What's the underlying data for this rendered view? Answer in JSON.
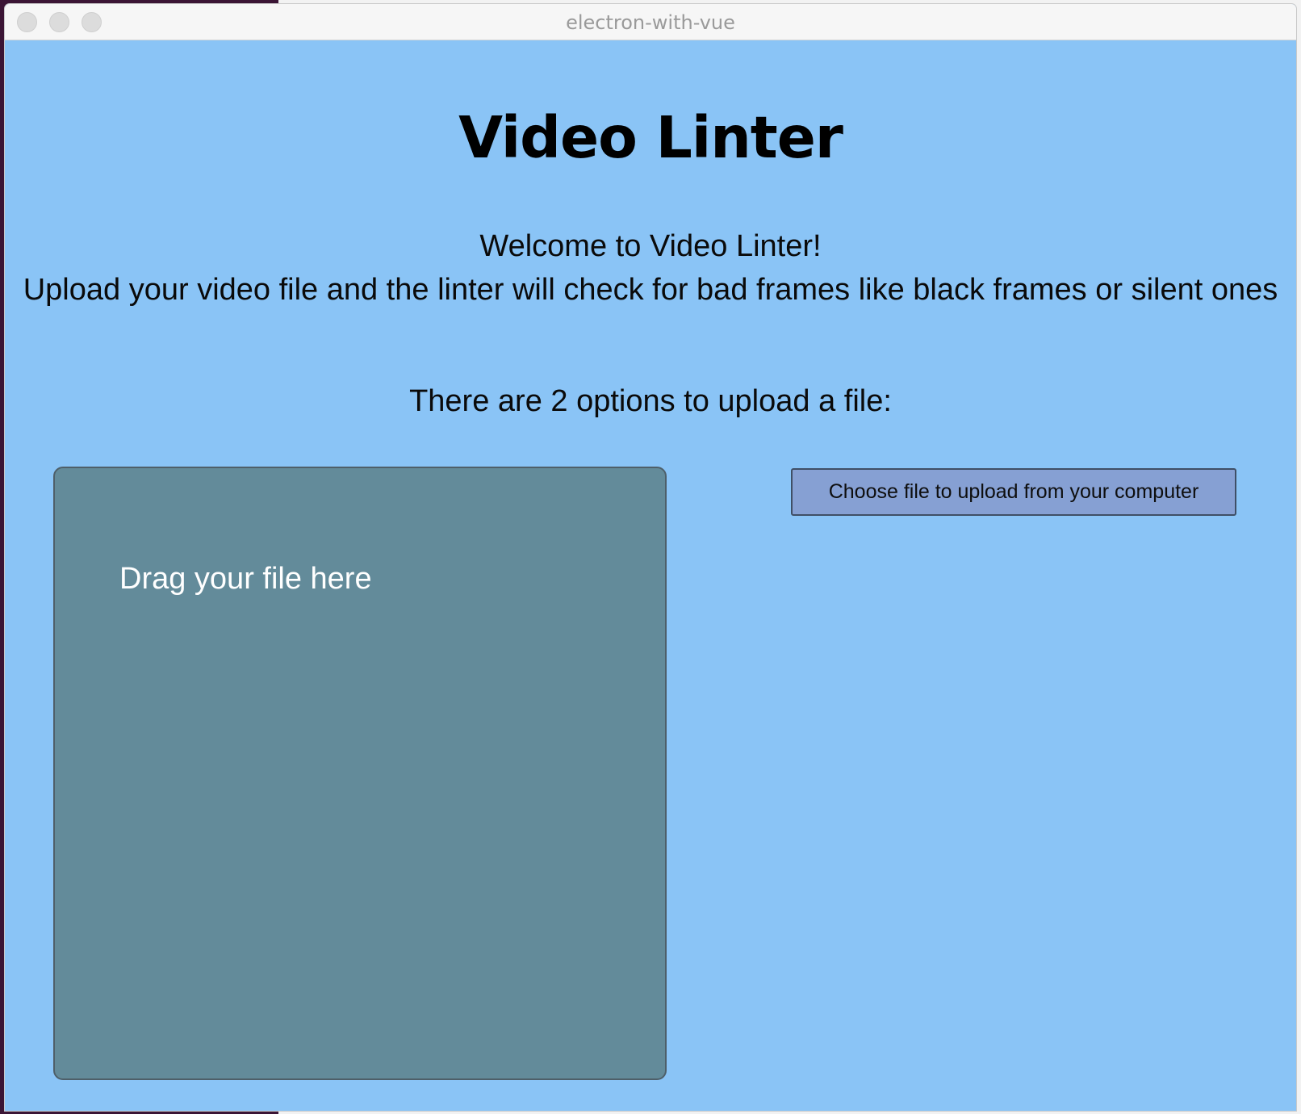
{
  "window": {
    "title": "electron-with-vue"
  },
  "app": {
    "title": "Video Linter",
    "intro_line1": "Welcome to Video Linter!",
    "intro_line2": "Upload your video file and the linter will check for bad frames like black frames or silent ones",
    "options_heading": "There are 2 options to upload a file:"
  },
  "dropzone": {
    "label": "Drag your file here"
  },
  "upload": {
    "button_label": "Choose file to upload from your computer"
  },
  "colors": {
    "background": "#8ac4f6",
    "dropzone": "#638b9a",
    "button": "#86a0d3"
  }
}
